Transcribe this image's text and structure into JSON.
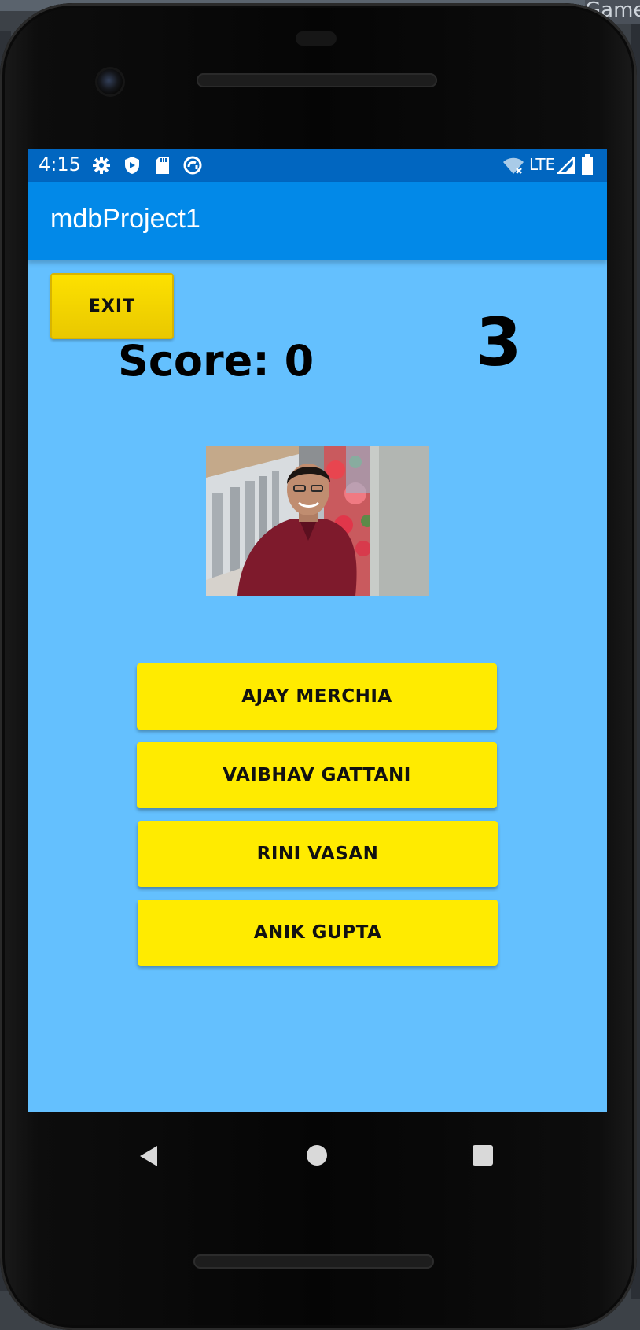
{
  "background_window": {
    "title_fragment": "Game"
  },
  "status_bar": {
    "time": "4:15",
    "left_icons": [
      "gear-icon",
      "shield-icon",
      "sd-card-icon",
      "sync-icon"
    ],
    "network": "LTE",
    "right_icons": [
      "wifi-off-icon",
      "signal-icon",
      "battery-icon"
    ]
  },
  "app_bar": {
    "title": "mdbProject1"
  },
  "game": {
    "exit_label": "EXIT",
    "score_label": "Score: 0",
    "countdown": "3",
    "photo_icon": "person-photo"
  },
  "answers": [
    {
      "label": "AJAY MERCHIA"
    },
    {
      "label": "VAIBHAV GATTANI"
    },
    {
      "label": "RINI VASAN"
    },
    {
      "label": "ANIK GUPTA"
    }
  ],
  "nav_bar": {
    "icons": [
      "back-icon",
      "home-icon",
      "recents-icon"
    ]
  },
  "colors": {
    "status_bar": "#0166c0",
    "app_bar": "#0289e8",
    "screen_background": "#64c0fe",
    "button_yellow": "#ffeb00"
  }
}
